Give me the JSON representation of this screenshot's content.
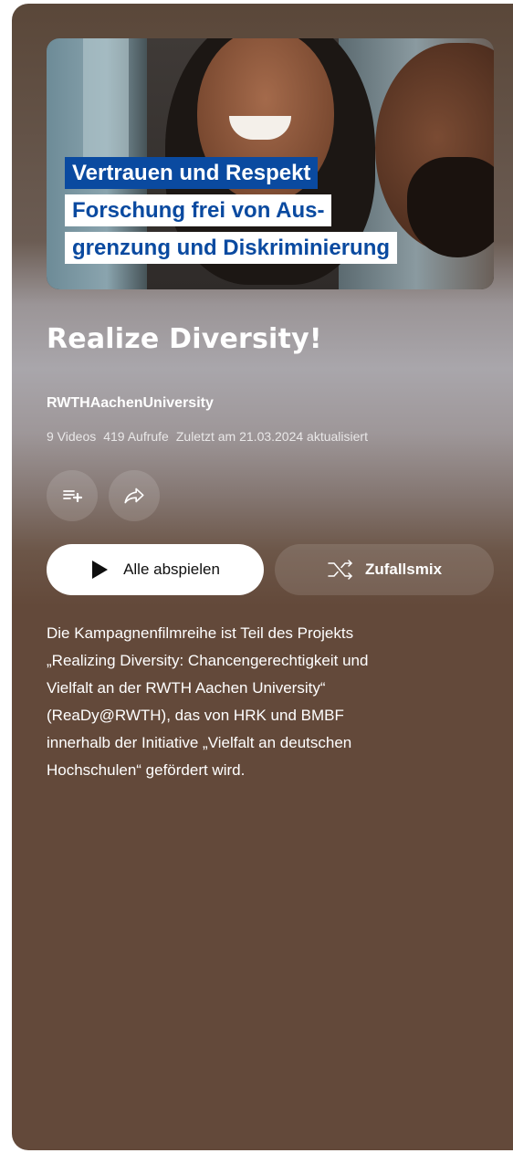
{
  "thumbnail": {
    "overlay_lines": [
      "Vertrauen und Respekt",
      "Forschung frei von Aus-",
      "grenzung und Diskriminierung"
    ]
  },
  "playlist": {
    "title": "Realize Diversity!",
    "channel": "RWTHAachenUniversity",
    "video_count": "9 Videos",
    "views": "419 Aufrufe",
    "updated": "Zuletzt am 21.03.2024 aktualisiert"
  },
  "actions": {
    "save_icon": "playlist-add-icon",
    "share_icon": "share-icon",
    "play_all_label": "Alle abspielen",
    "shuffle_label": "Zufallsmix"
  },
  "description": "Die Kampagnenfilmreihe ist Teil des Projekts\n„Realizing Diversity: Chancengerechtigkeit und\nVielfalt an der RWTH Aachen University“\n(ReaDy@RWTH), das von HRK und BMBF\ninnerhalb der Initiative „Vielfalt an deutschen\nHochschulen“ gefördert wird.",
  "colors": {
    "panel_brown": "#63493a",
    "overlay_blue": "#0a4aa0"
  }
}
